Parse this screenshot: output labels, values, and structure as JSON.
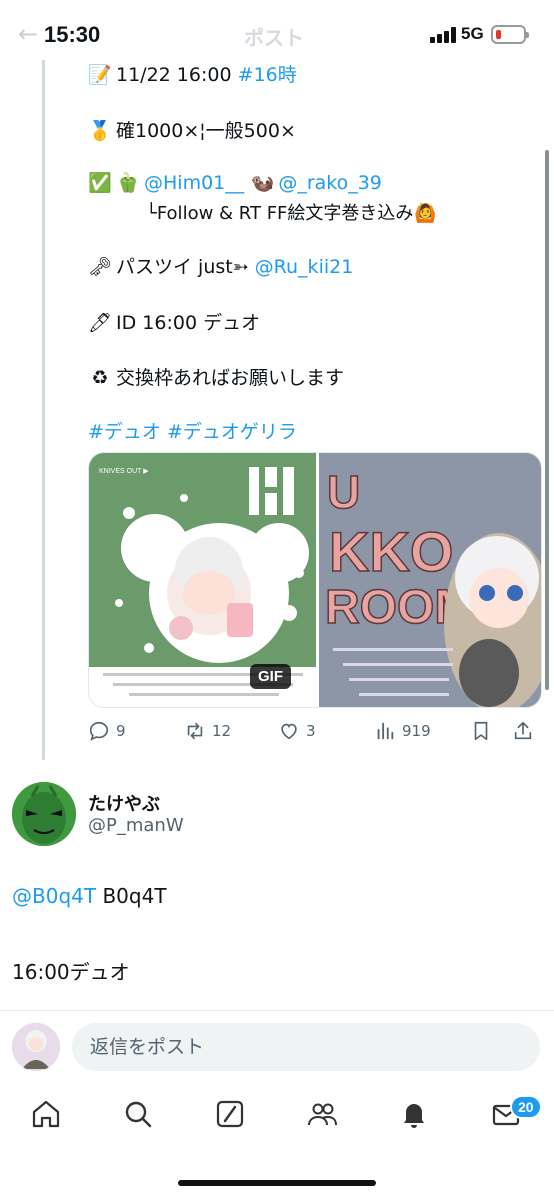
{
  "status_bar": {
    "time": "15:30",
    "network": "5G",
    "title": "ポスト",
    "back_icon": "arrow-left-icon"
  },
  "tweet": {
    "lines": [
      {
        "icon": "memo",
        "text_pre": "11/22 16:00 ",
        "link": "#16時",
        "text_post": ""
      },
      {
        "icon": "medal",
        "text_pre": "確1000×¦一般500×",
        "link": "",
        "text_post": ""
      },
      {
        "icon": "check-pepper",
        "text_pre": "",
        "link": "@Him01__",
        "text_mid": "  ",
        "link2": "@_rako_39"
      },
      {
        "icon": "",
        "text_pre": "└Follow & RT FF絵文字巻き込み",
        "link": "",
        "text_post": ""
      },
      {
        "icon": "key",
        "text_pre": "パスツイ just➳ ",
        "link": "@Ru_kii21",
        "text_post": ""
      },
      {
        "icon": "pen",
        "text_pre": "ID 16:00 デュオ",
        "link": "",
        "text_post": ""
      },
      {
        "icon": "recycle",
        "text_pre": "交換枠あればお願いします",
        "link": "",
        "text_post": ""
      },
      {
        "icon": "",
        "text_pre": "",
        "link": "#デュオ #デュオゲリラ",
        "text_post": ""
      }
    ],
    "media": {
      "left_title": "KNIVES OUT ▶",
      "left_letter": "H",
      "right_text_1": "U",
      "right_text_2": "KKO",
      "right_text_3": "ROOM",
      "gif_label": "GIF"
    },
    "actions": {
      "replies": "9",
      "reposts": "12",
      "likes": "3",
      "views": "919"
    }
  },
  "reply": {
    "name": "たけやぶ",
    "handle": "@P_manW",
    "mention": "@B0q4T",
    "line1_rest": " B0q4T",
    "line2": "16:00デュオ"
  },
  "composer": {
    "placeholder": "返信をポスト"
  },
  "tabbar": {
    "messages_badge": "20"
  },
  "colors": {
    "accent": "#1d9bf0",
    "text": "#0f1419",
    "muted": "#536471"
  }
}
